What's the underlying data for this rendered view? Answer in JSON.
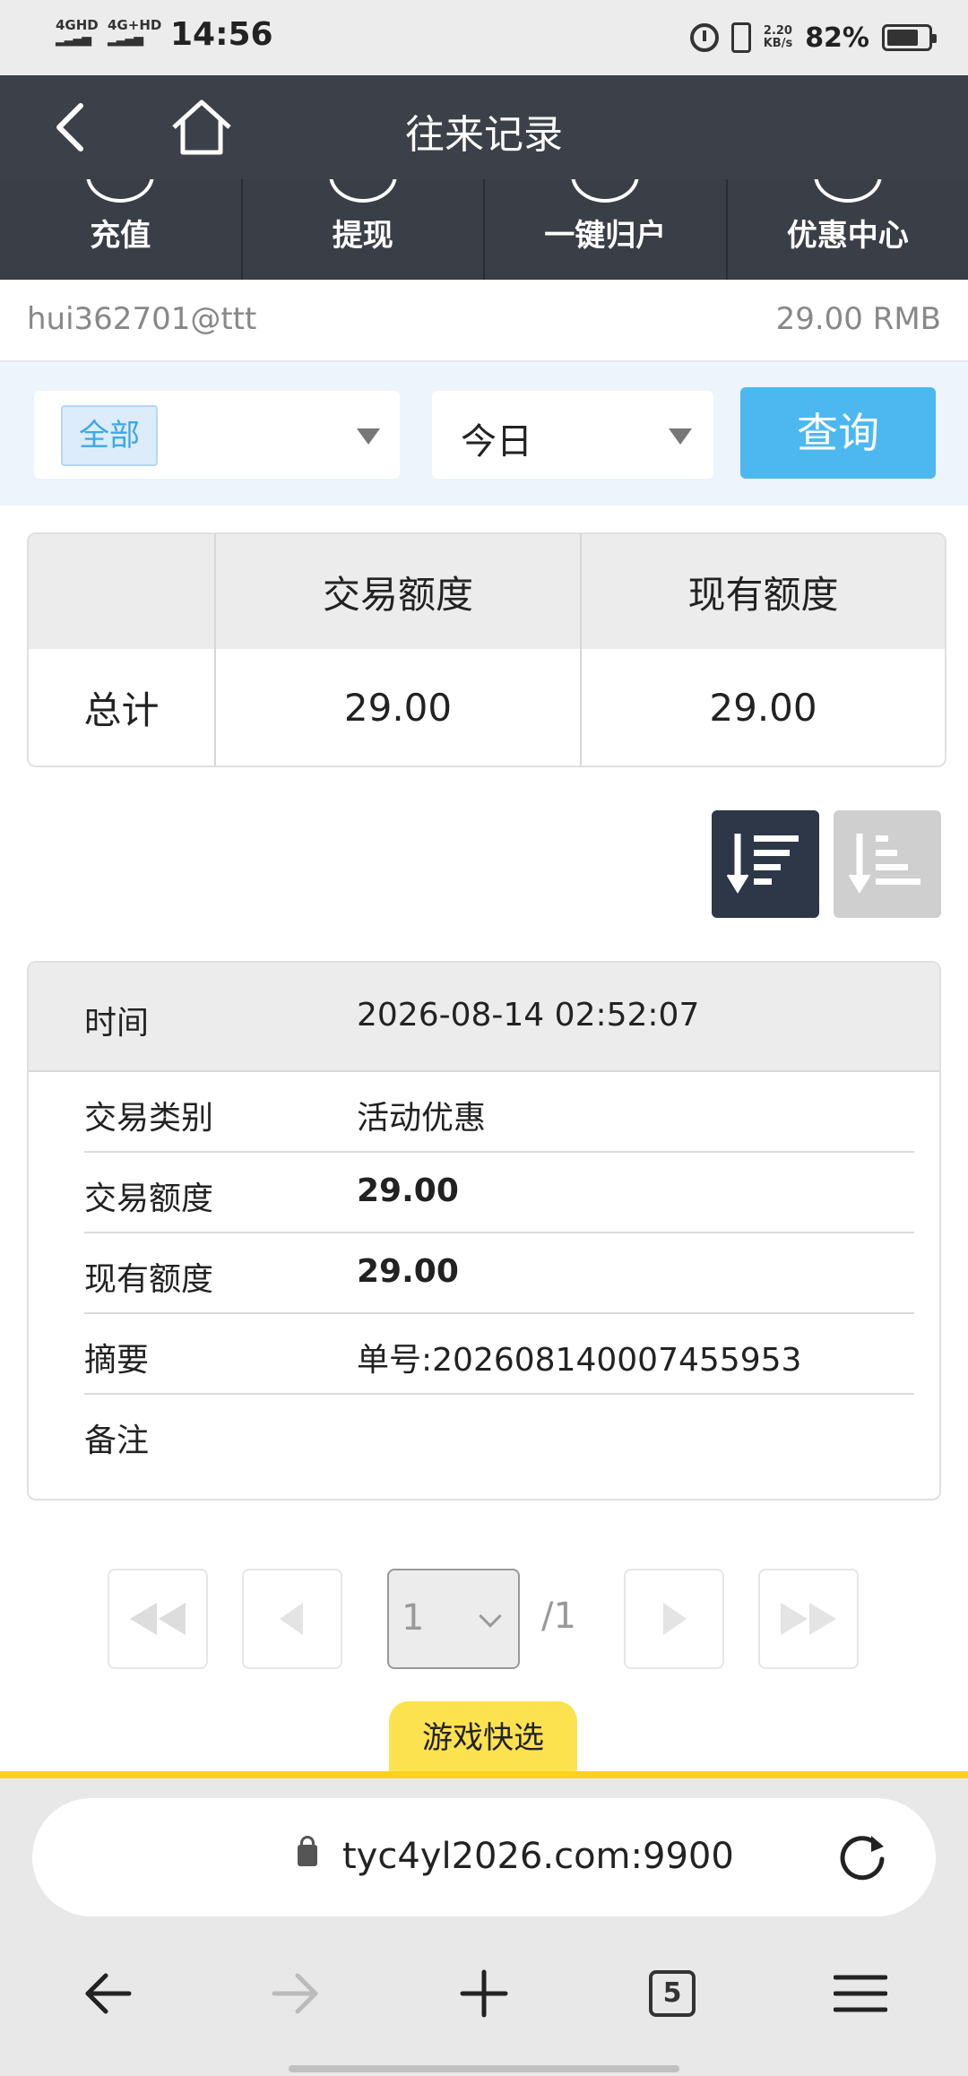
{
  "status_bar": {
    "net1": "4GHD",
    "net2": "4G+HD",
    "time": "14:56",
    "speed_value": "2.20",
    "speed_unit": "KB/s",
    "battery": "82%"
  },
  "header": {
    "title": "往来记录",
    "back_icon": "chevron-left-icon",
    "home_icon": "home-icon"
  },
  "nav": {
    "items": [
      {
        "label": "充值",
        "icon": "deposit-icon"
      },
      {
        "label": "提现",
        "icon": "withdraw-icon"
      },
      {
        "label": "一键归户",
        "icon": "transfer-icon"
      },
      {
        "label": "优惠中心",
        "icon": "promo-icon"
      }
    ]
  },
  "account": {
    "username": "hui362701@ttt",
    "balance": "29.00 RMB"
  },
  "filter": {
    "type_value": "全部",
    "date_value": "今日",
    "query_label": "查询"
  },
  "summary": {
    "headers": [
      "",
      "交易额度",
      "现有额度"
    ],
    "row_label": "总计",
    "values": [
      "29.00",
      "29.00"
    ]
  },
  "record": {
    "time_label": "时间",
    "time_value": "2026-08-14 02:52:07",
    "rows": [
      {
        "label": "交易类别",
        "value": "活动优惠"
      },
      {
        "label": "交易额度",
        "value": "29.00"
      },
      {
        "label": "现有额度",
        "value": "29.00"
      },
      {
        "label": "摘要",
        "value": "单号:202608140007455953"
      },
      {
        "label": "备注",
        "value": ""
      }
    ]
  },
  "pagination": {
    "current": "1",
    "total": "/1"
  },
  "game_quick": "游戏快选",
  "browser": {
    "url": "tyc4yl2026.com:9900",
    "tab_count": "5"
  },
  "colors": {
    "header_bg": "#3c4149",
    "accent": "#4db8f0",
    "yellow": "#fbd11c",
    "sort_active": "#2d3748"
  }
}
